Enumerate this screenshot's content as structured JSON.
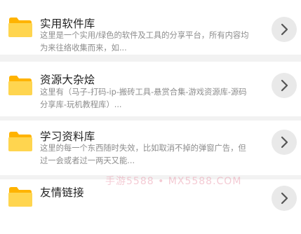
{
  "items": [
    {
      "title": "实用软件库",
      "description": "这里是一个实用/绿色的软件及工具的分享平台，所有内容均为来往络收集而来，如...",
      "icon": "folder-icon",
      "action_icon": "chevron-right-icon"
    },
    {
      "title": "资源大杂烩",
      "description": "这里有（马子-打码-ip-搬砖工具-悬赏合集-游戏资源库-源码分享库-玩机教程库）...",
      "icon": "folder-icon",
      "action_icon": "chevron-right-icon"
    },
    {
      "title": "学习资料库",
      "description": "这里的每一个东西随时失效，比如取消不掉的弹窗广告，但过一会或者过一两天又能...",
      "icon": "folder-icon",
      "action_icon": "chevron-right-icon"
    },
    {
      "title": "友情链接",
      "description": "",
      "icon": "folder-icon",
      "action_icon": "chevron-right-icon"
    }
  ],
  "watermark": "手游5588 • MX5588.COM",
  "colors": {
    "folder_body": "#FFD54F",
    "folder_tab": "#FFB300",
    "background": "#F2F2F2",
    "title_text": "#222222",
    "description_text": "#8C8C8C",
    "arrow_button_bg": "#E9E9E9"
  }
}
